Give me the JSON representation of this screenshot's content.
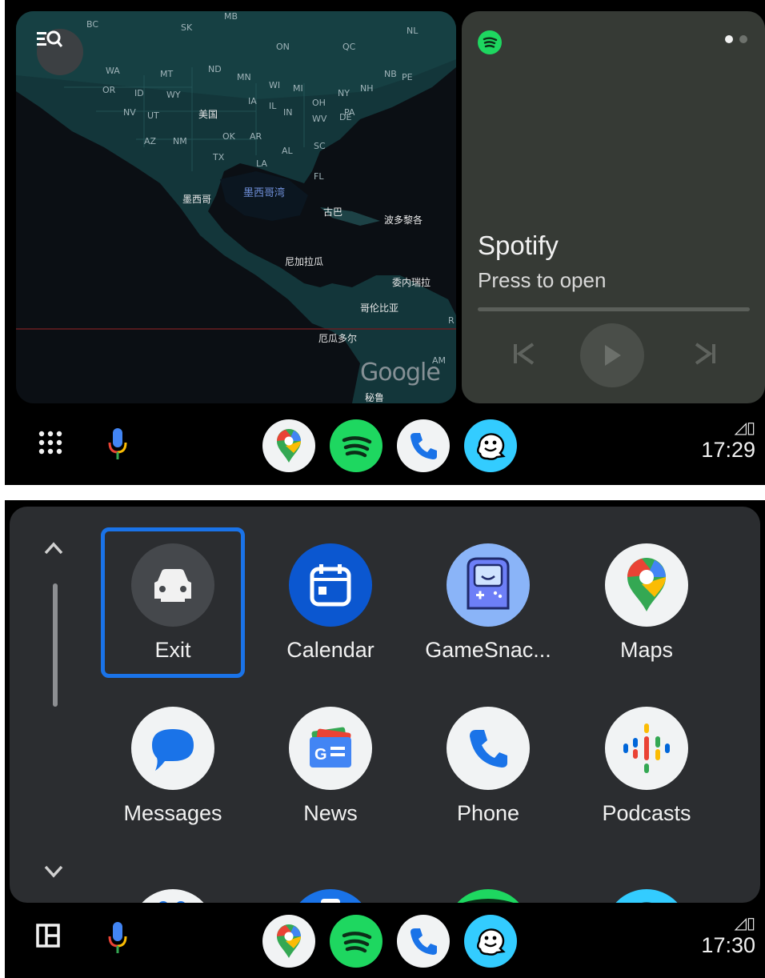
{
  "top": {
    "map": {
      "labels_states": [
        "BC",
        "SK",
        "MB",
        "ON",
        "QC",
        "NL",
        "WA",
        "MT",
        "ND",
        "MN",
        "WI",
        "MI",
        "NY",
        "NH",
        "NB",
        "PE",
        "OR",
        "ID",
        "WY",
        "IA",
        "IL",
        "IN",
        "OH",
        "PA",
        "NV",
        "UT",
        "WV",
        "DE",
        "AZ",
        "NM",
        "OK",
        "AR",
        "AL",
        "SC",
        "TX",
        "LA",
        "FL",
        "R",
        "AM"
      ],
      "label_usa": "美国",
      "label_mexico": "墨西哥",
      "label_gulf": "墨西哥湾",
      "label_cuba": "古巴",
      "label_puerto_rico": "波多黎各",
      "label_nicaragua": "尼加拉瓜",
      "label_venezuela": "委内瑞拉",
      "label_colombia": "哥伦比亚",
      "label_ecuador": "厄瓜多尔",
      "label_peru": "秘鲁",
      "watermark": "Google",
      "search_icon": "search-list-icon"
    },
    "media": {
      "app_icon": "spotify-icon",
      "title": "Spotify",
      "subtitle": "Press to open",
      "progress": 0,
      "page_indicator": {
        "count": 2,
        "active": 0
      },
      "controls": [
        "skip-previous-icon",
        "play-icon",
        "skip-next-icon"
      ]
    },
    "rail": {
      "left_icons": [
        "app-grid-icon",
        "microphone-icon"
      ],
      "dock_apps": [
        "maps-icon",
        "spotify-icon",
        "phone-icon",
        "waze-icon"
      ],
      "signal": "◿",
      "battery": "▯",
      "clock": "17:29"
    }
  },
  "bottom": {
    "launcher": {
      "scroll": [
        "chevron-up-icon",
        "chevron-down-icon"
      ],
      "apps": [
        {
          "label": "Exit",
          "icon": "car-icon",
          "focused": true
        },
        {
          "label": "Calendar",
          "icon": "calendar-icon"
        },
        {
          "label": "GameSnac...",
          "icon": "gamesnacks-icon"
        },
        {
          "label": "Maps",
          "icon": "maps-icon"
        },
        {
          "label": "Messages",
          "icon": "messages-icon"
        },
        {
          "label": "News",
          "icon": "news-icon"
        },
        {
          "label": "Phone",
          "icon": "phone-icon"
        },
        {
          "label": "Podcasts",
          "icon": "podcasts-icon"
        }
      ],
      "colors": {
        "focus": "#1a73e8",
        "background": "#2b2d30"
      }
    },
    "rail": {
      "left_icons": [
        "split-screen-icon",
        "microphone-icon"
      ],
      "dock_apps": [
        "maps-icon",
        "spotify-icon",
        "phone-icon",
        "waze-icon"
      ],
      "signal": "◿",
      "battery": "▯",
      "clock": "17:30"
    }
  }
}
